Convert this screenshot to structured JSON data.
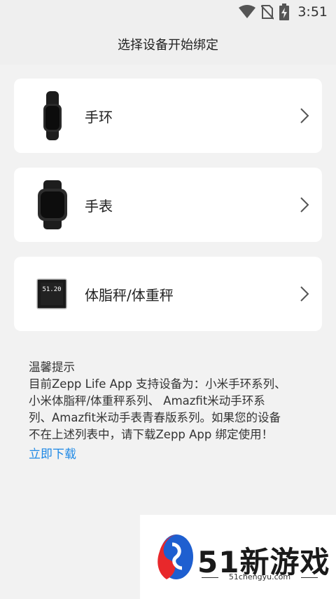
{
  "status_bar": {
    "time": "3:51",
    "icons": [
      "wifi-icon",
      "no-sim-icon",
      "battery-charging-icon"
    ]
  },
  "header": {
    "title": "选择设备开始绑定"
  },
  "devices": [
    {
      "label": "手环",
      "icon": "band-icon"
    },
    {
      "label": "手表",
      "icon": "watch-icon"
    },
    {
      "label": "体脂秤/体重秤",
      "icon": "scale-icon",
      "scale_reading": "51.20"
    }
  ],
  "tips": {
    "title": "温馨提示",
    "body": "目前Zepp Life App 支持设备为：小米手环系列、\n小米体脂秤/体重秤系列、 Amazfit米动手环系\n列、Amazfit米动手表青春版系列。如果您的设备\n不在上述列表中，请下载Zepp App 绑定使用！",
    "download_label": "立即下载",
    "link_color": "#1e88e5"
  },
  "watermark": {
    "title": "51新游戏",
    "subtitle": "51chengyu.com"
  }
}
